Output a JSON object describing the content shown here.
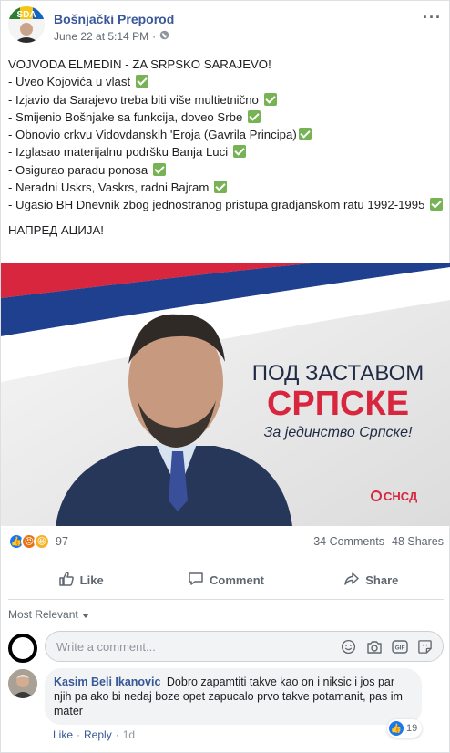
{
  "post": {
    "page_name": "Bošnjački Preporod",
    "timestamp": "June 22 at 5:14 PM",
    "more_label": "···",
    "audience_icon": "globe-icon",
    "text": {
      "title": "VOJVODA ELMEDIN - ZA SRPSKO SARAJEVO!",
      "items": [
        "- Uveo Kojovića u vlast",
        "- Izjavio da Sarajevo treba biti više multietnično",
        "- Smijenio Bošnjake sa funkcija, doveo Srbe",
        "- Obnovio crkvu Vidovdanskih 'Eroja (Gavrila Principa)",
        "- Izglasao materijalnu podršku Banja Luci",
        "- Osigurao paradu ponosa",
        "- Neradni Uskrs, Vaskrs, radni Bajram",
        "- Ugasio BH Dnevnik zbog jednostranog pristupa gradjanskom ratu 1992-1995"
      ],
      "closing": "НАПРЕД АЦИЈА!"
    },
    "image": {
      "headline_top": "ПОД ЗАСТАВОМ",
      "headline_main": "СРПСКЕ",
      "subline": "За јединство Српске!",
      "party_logo": "СНСД"
    },
    "colors": {
      "link": "#385898",
      "flag_red": "#d7263d",
      "flag_blue": "#1f3f8f",
      "check": "#77b255",
      "like_blue": "#1877f2"
    }
  },
  "stats": {
    "reaction_count": "97",
    "comments": "34 Comments",
    "shares": "48 Shares"
  },
  "actions": {
    "like": "Like",
    "comment": "Comment",
    "share": "Share"
  },
  "comments": {
    "sort_label": "Most Relevant",
    "composer_placeholder": "Write a comment...",
    "list": [
      {
        "author": "Kasim Beli Ikanovic",
        "text": "Dobro zapamtiti takve kao on i niksic i jos par njih pa ako bi nedaj boze opet zapucalo prvo takve potamanit, pas im mater",
        "reaction_count": "19",
        "like_label": "Like",
        "reply_label": "Reply",
        "age": "1d"
      }
    ]
  }
}
